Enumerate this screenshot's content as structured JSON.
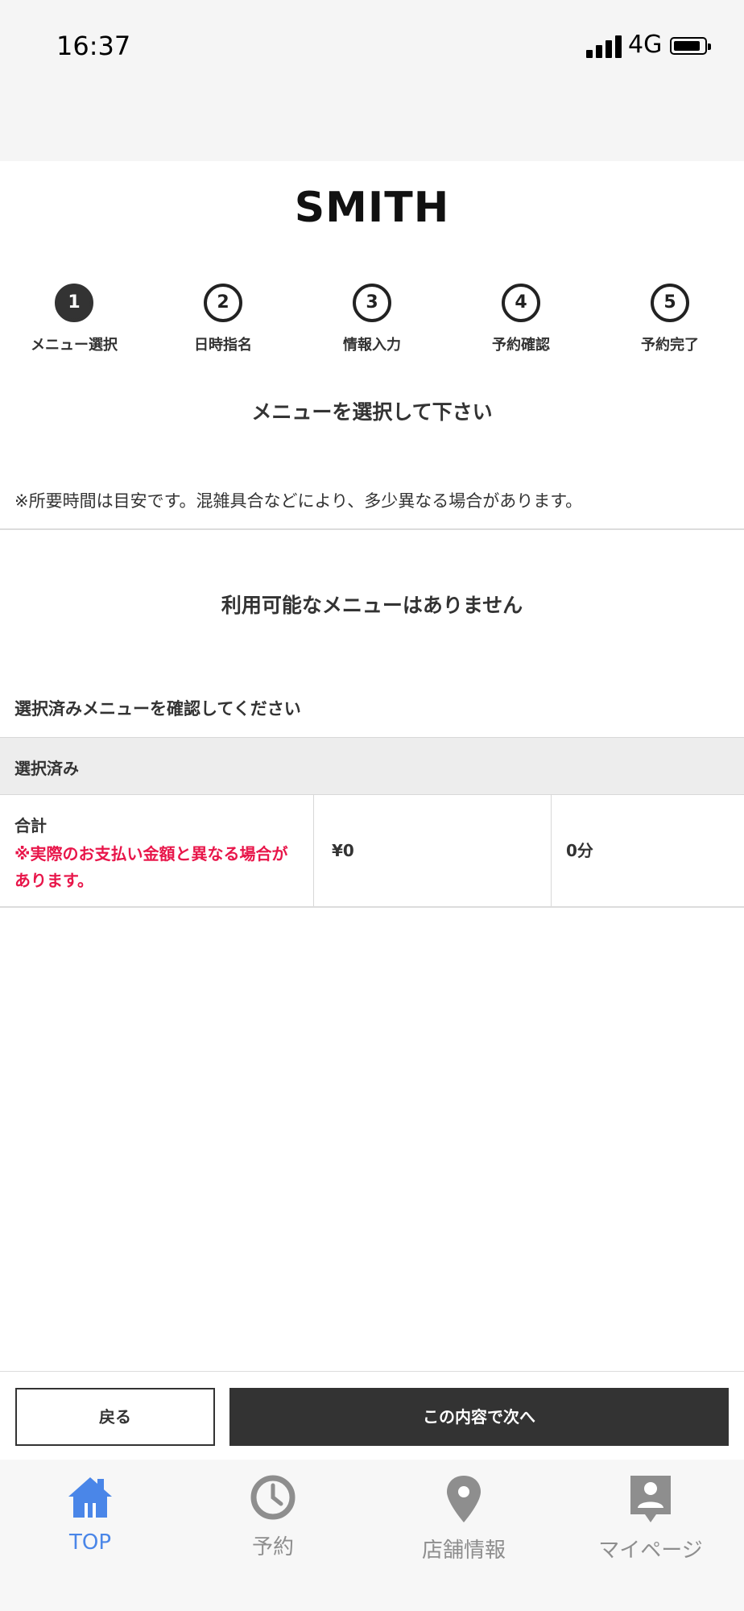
{
  "status_bar": {
    "time": "16:37",
    "network": "4G"
  },
  "brand": {
    "logo": "SMITH"
  },
  "steps": [
    {
      "number": "1",
      "label": "メニュー選択"
    },
    {
      "number": "2",
      "label": "日時指名"
    },
    {
      "number": "3",
      "label": "情報入力"
    },
    {
      "number": "4",
      "label": "予約確認"
    },
    {
      "number": "5",
      "label": "予約完了"
    }
  ],
  "main": {
    "instruction": "メニューを選択して下さい",
    "note": "※所要時間は目安です。混雑具合などにより、多少異なる場合があります。",
    "empty_message": "利用可能なメニューはありません",
    "confirm_heading": "選択済みメニューを確認してください",
    "selected_header": "選択済み",
    "total": {
      "label": "合計",
      "warning": "※実際のお支払い金額と異なる場合があります。",
      "price": "¥0",
      "duration": "0分"
    }
  },
  "buttons": {
    "back": "戻る",
    "next": "この内容で次へ"
  },
  "tabbar": {
    "items": [
      {
        "label": "TOP",
        "icon": "home-icon",
        "active": true
      },
      {
        "label": "予約",
        "icon": "clock-icon",
        "active": false
      },
      {
        "label": "店舗情報",
        "icon": "map-pin-icon",
        "active": false
      },
      {
        "label": "マイページ",
        "icon": "profile-icon",
        "active": false
      }
    ]
  },
  "colors": {
    "accent": "#4a86e8",
    "warning": "#e8164a",
    "dark": "#333333",
    "inactive_icon": "#8e8e8e"
  }
}
